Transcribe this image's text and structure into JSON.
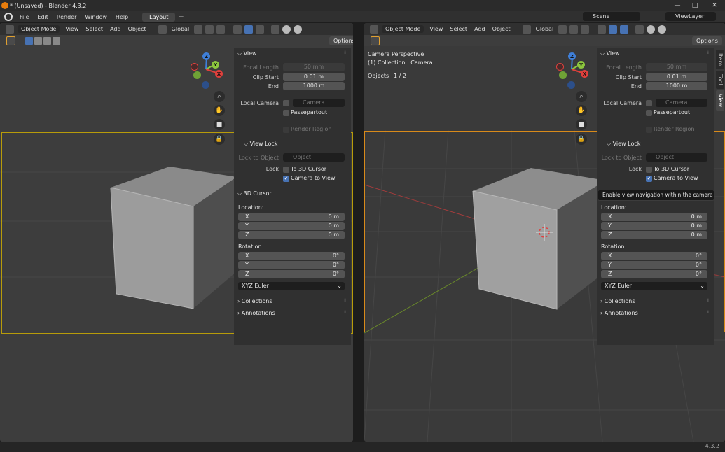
{
  "window": {
    "title": "* (Unsaved) - Blender 4.3.2",
    "minimize": "—",
    "maximize": "□",
    "close": "✕"
  },
  "menu": {
    "items": [
      "File",
      "Edit",
      "Render",
      "Window",
      "Help"
    ],
    "workspace_tab": "Layout",
    "add_tab": "+",
    "scene": "Scene",
    "view_layer": "ViewLayer"
  },
  "header": {
    "mode": "Object Mode",
    "menus": [
      "View",
      "Select",
      "Add",
      "Object"
    ],
    "orientation": "Global",
    "options": "Options"
  },
  "right_viewport": {
    "line1": "Camera Perspective",
    "line2": "(1) Collection | Camera",
    "objects_label": "Objects",
    "objects_value": "1 / 2"
  },
  "side_tabs": [
    "Item",
    "Tool",
    "View"
  ],
  "panel": {
    "view_header": "View",
    "focal_length_label": "Focal Length",
    "focal_length": "50 mm",
    "clip_start_label": "Clip Start",
    "clip_start": "0.01 m",
    "end_label": "End",
    "end": "1000 m",
    "local_camera_label": "Local Camera",
    "local_camera_value": "Camera",
    "passepartout": "Passepartout",
    "render_region": "Render Region",
    "view_lock_header": "View Lock",
    "lock_to_object_label": "Lock to Object",
    "lock_to_object_value": "Object",
    "lock_label": "Lock",
    "to_3d_cursor": "To 3D Cursor",
    "camera_to_view": "Camera to View",
    "cursor_header": "3D Cursor",
    "location_label": "Location:",
    "rotation_label": "Rotation:",
    "x": "X",
    "y": "Y",
    "z": "Z",
    "loc_x": "0 m",
    "loc_y": "0 m",
    "loc_z": "0 m",
    "rot_x": "0°",
    "rot_y": "0°",
    "rot_z": "0°",
    "rotation_mode": "XYZ Euler",
    "collections": "Collections",
    "annotations": "Annotations"
  },
  "tooltip": "Enable view navigation within the camera view.",
  "status": {
    "version": "4.3.2"
  },
  "colors": {
    "accent": "#4772b3",
    "camera_frame": "#b89c0a",
    "axis_x": "#e0403c",
    "axis_y": "#8cc63e",
    "axis_z": "#3f7fd8"
  }
}
